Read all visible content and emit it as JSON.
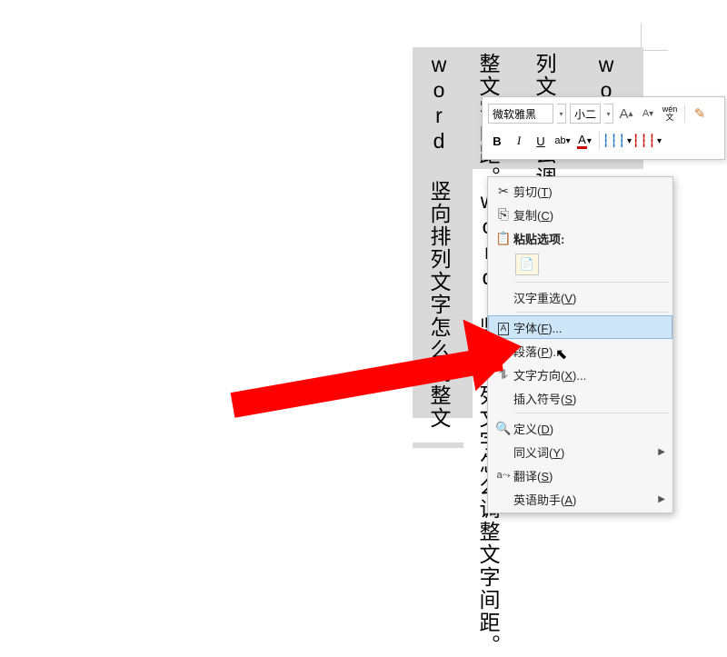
{
  "doc_columns": {
    "c1": "word 竖向排列文字怎么调整文",
    "c2": "整文字间距。word 竖向排列文字怎么调整文字间距。",
    "c3": "列文字怎么调整",
    "c4": "word 竖向排列"
  },
  "mini_toolbar": {
    "font_name": "微软雅黑",
    "font_size": "小二",
    "grow": "A",
    "shrink": "A",
    "wen": "wén",
    "wen_sub": "文",
    "bold": "B",
    "italic": "I",
    "underline": "U",
    "highlight": "ab",
    "font_color": "A",
    "char_space_b": "┆┆┆",
    "char_space_r": "┆┆┆"
  },
  "ctx": {
    "cut": "剪切",
    "cut_k": "T",
    "copy": "复制",
    "copy_k": "C",
    "paste_hdr": "粘贴选项:",
    "han": "汉字重选",
    "han_k": "V",
    "font": "字体",
    "font_k": "F",
    "para": "段落",
    "para_k": "P",
    "dir": "文字方向",
    "dir_k": "X",
    "sym": "插入符号",
    "sym_k": "S",
    "def": "定义",
    "def_k": "D",
    "syn": "同义词",
    "syn_k": "Y",
    "tran": "翻译",
    "tran_k": "S",
    "eng": "英语助手",
    "eng_k": "A"
  }
}
